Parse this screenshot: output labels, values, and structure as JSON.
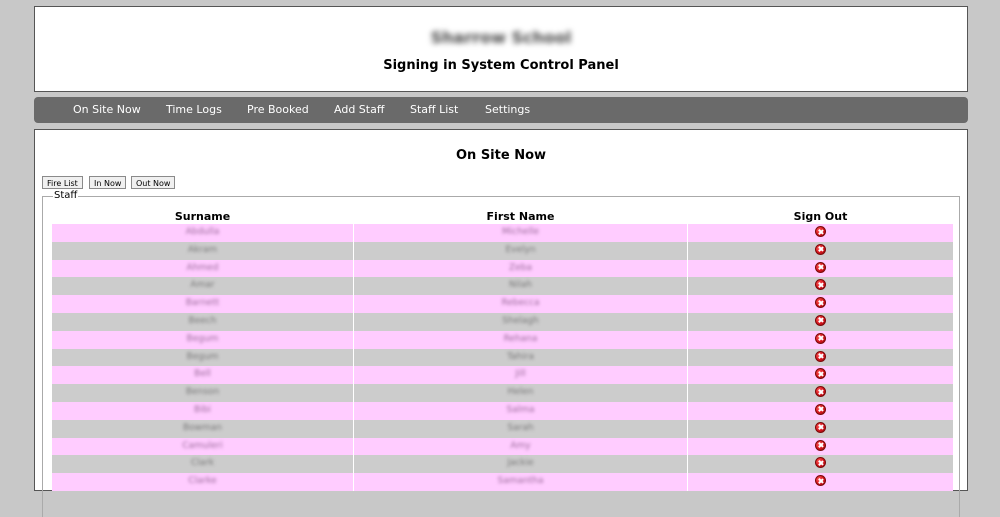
{
  "header": {
    "school_name": "Sharrow School",
    "panel_title": "Signing in System Control Panel"
  },
  "nav": {
    "items": [
      {
        "label": "On Site Now"
      },
      {
        "label": "Time Logs"
      },
      {
        "label": "Pre Booked"
      },
      {
        "label": "Add Staff"
      },
      {
        "label": "Staff List"
      },
      {
        "label": "Settings"
      }
    ]
  },
  "content": {
    "title": "On Site Now",
    "buttons": {
      "fire_list": "Fire List",
      "in_now": "In Now",
      "out_now": "Out Now"
    },
    "section_legend": "Staff",
    "columns": {
      "surname": "Surname",
      "first_name": "First Name",
      "sign_out": "Sign Out"
    },
    "rows": [
      {
        "surname": "Abdulla",
        "first_name": "Michelle"
      },
      {
        "surname": "Akram",
        "first_name": "Evelyn"
      },
      {
        "surname": "Ahmed",
        "first_name": "Zeba"
      },
      {
        "surname": "Amar",
        "first_name": "Nilah"
      },
      {
        "surname": "Barnett",
        "first_name": "Rebecca"
      },
      {
        "surname": "Beech",
        "first_name": "Shelagh"
      },
      {
        "surname": "Begum",
        "first_name": "Rehana"
      },
      {
        "surname": "Begum",
        "first_name": "Tahira"
      },
      {
        "surname": "Bell",
        "first_name": "Jill"
      },
      {
        "surname": "Benson",
        "first_name": "Helen"
      },
      {
        "surname": "Bibi",
        "first_name": "Salma"
      },
      {
        "surname": "Bowman",
        "first_name": "Sarah"
      },
      {
        "surname": "Camuleri",
        "first_name": "Amy"
      },
      {
        "surname": "Clark",
        "first_name": "Jackie"
      },
      {
        "surname": "Clarke",
        "first_name": "Samantha"
      }
    ],
    "colors": {
      "row_odd": "#ffccff",
      "row_even": "#cccccc",
      "nav_bg": "#6a6a6a",
      "page_bg": "#c8c8c8"
    }
  }
}
